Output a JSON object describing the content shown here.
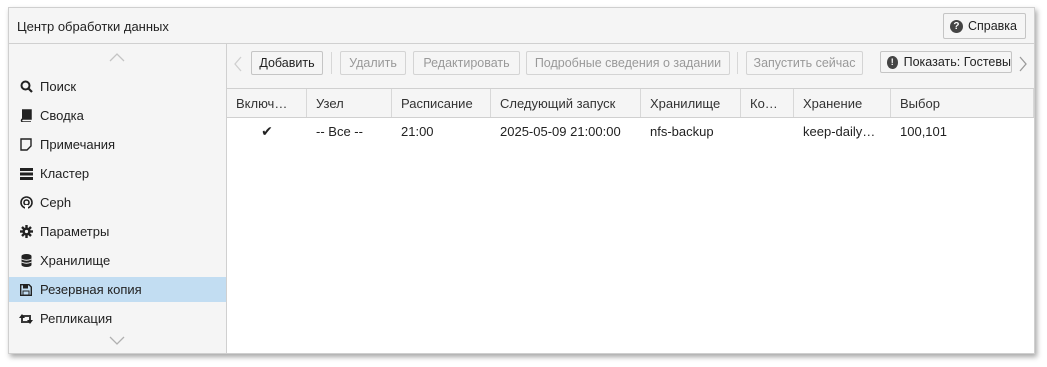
{
  "window": {
    "title": "Центр обработки данных",
    "help_label": "Справка"
  },
  "sidebar": {
    "items": [
      {
        "label": "Поиск",
        "icon": "search-icon"
      },
      {
        "label": "Сводка",
        "icon": "book-icon"
      },
      {
        "label": "Примечания",
        "icon": "note-icon"
      },
      {
        "label": "Кластер",
        "icon": "server-icon"
      },
      {
        "label": "Ceph",
        "icon": "ceph-icon"
      },
      {
        "label": "Параметры",
        "icon": "gear-icon"
      },
      {
        "label": "Хранилище",
        "icon": "database-icon"
      },
      {
        "label": "Резервная копия",
        "icon": "floppy-icon",
        "active": true
      },
      {
        "label": "Репликация",
        "icon": "retweet-icon"
      }
    ]
  },
  "toolbar": {
    "add": "Добавить",
    "remove": "Удалить",
    "edit": "Редактировать",
    "details": "Подробные сведения о задании",
    "run_now": "Запустить сейчас",
    "show": "Показать: Гостевы"
  },
  "grid": {
    "columns": [
      "Включ…",
      "Узел",
      "Расписание",
      "Следующий запуск",
      "Хранилище",
      "Ко…",
      "Хранение",
      "Выбор"
    ],
    "rows": [
      {
        "enabled": "✔",
        "node": "-- Все --",
        "schedule": "21:00",
        "next_run": "2025-05-09 21:00:00",
        "storage": "nfs-backup",
        "comment": "",
        "retention": "keep-daily…",
        "selection": "100,101"
      }
    ]
  },
  "colors": {
    "active_item": "#c2ddf2",
    "panel_bg": "#f5f5f5"
  }
}
